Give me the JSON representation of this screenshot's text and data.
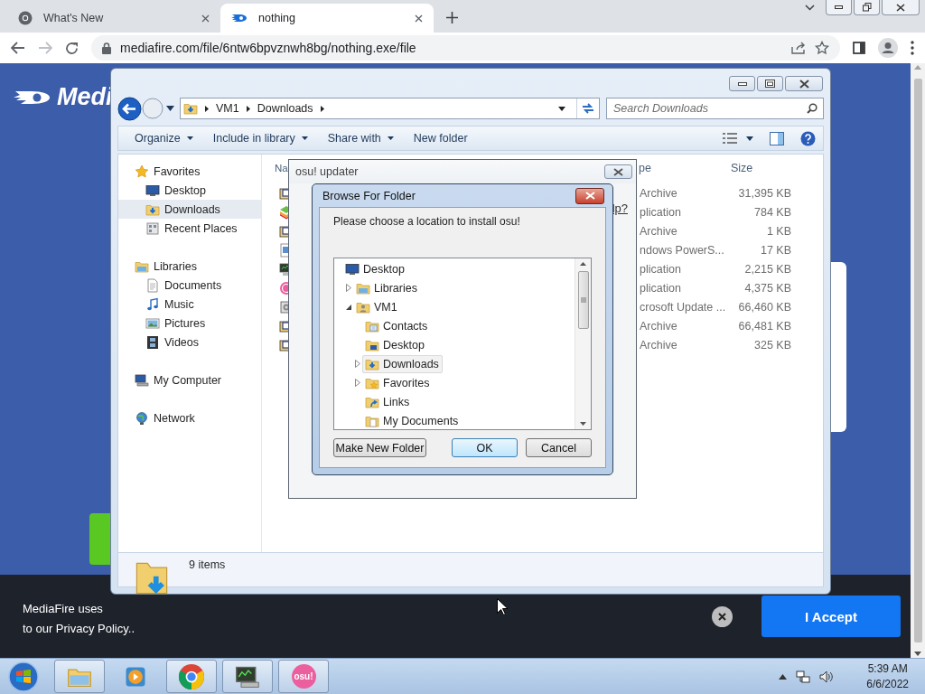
{
  "browser": {
    "tabs": [
      {
        "title": "What's New",
        "selected": false,
        "kind": "chrome"
      },
      {
        "title": "nothing",
        "selected": true,
        "kind": "mediafire"
      }
    ],
    "url": "mediafire.com/file/6ntw6bpvznwh8bg/nothing.exe/file"
  },
  "page": {
    "logo_text": "Medi",
    "cookie_banner": {
      "line_1": "MediaFire uses",
      "line_2": "to our Privacy Policy..",
      "accept": "I Accept"
    }
  },
  "explorer": {
    "breadcrumb": [
      "VM1",
      "Downloads"
    ],
    "search": {
      "placeholder": "Search Downloads"
    },
    "toolbar": [
      {
        "label": "Organize",
        "dropdown": true
      },
      {
        "label": "Include in library",
        "dropdown": true
      },
      {
        "label": "Share with",
        "dropdown": true
      },
      {
        "label": "New folder",
        "dropdown": false
      }
    ],
    "nav": [
      {
        "label": "Favorites",
        "kind": "star",
        "selected": false,
        "items": [
          {
            "label": "Desktop",
            "kind": "desktop",
            "selected": false
          },
          {
            "label": "Downloads",
            "kind": "downloads",
            "selected": true
          },
          {
            "label": "Recent Places",
            "kind": "recent",
            "selected": false
          }
        ]
      },
      {
        "label": "Libraries",
        "kind": "libraries",
        "selected": false,
        "items": [
          {
            "label": "Documents",
            "kind": "document",
            "selected": false
          },
          {
            "label": "Music",
            "kind": "music",
            "selected": false
          },
          {
            "label": "Pictures",
            "kind": "pictures",
            "selected": false
          },
          {
            "label": "Videos",
            "kind": "videos",
            "selected": false
          }
        ]
      },
      {
        "label": "My Computer",
        "kind": "computer",
        "selected": false
      },
      {
        "label": "Network",
        "kind": "network",
        "selected": false
      }
    ],
    "columns": [
      "Na",
      "pe",
      "Size"
    ],
    "files": [
      {
        "kind": "archive",
        "type": "Archive",
        "size": "31,395 KB"
      },
      {
        "kind": "app",
        "type": "plication",
        "size": "784 KB"
      },
      {
        "kind": "archive",
        "type": "Archive",
        "size": "1 KB"
      },
      {
        "kind": "script",
        "type": "ndows PowerS...",
        "size": "17 KB"
      },
      {
        "kind": "monitor",
        "type": "plication",
        "size": "2,215 KB"
      },
      {
        "kind": "osu",
        "type": "plication",
        "size": "4,375 KB"
      },
      {
        "kind": "installer",
        "type": "crosoft Update ...",
        "size": "66,460 KB"
      },
      {
        "kind": "archive",
        "type": "Archive",
        "size": "66,481 KB"
      },
      {
        "kind": "archive",
        "type": "Archive",
        "size": "325 KB"
      }
    ],
    "status": "9 items"
  },
  "updater": {
    "title": "osu! updater",
    "link": "lp?"
  },
  "dialog": {
    "title": "Browse For Folder",
    "prompt": "Please choose a location to install osu!",
    "tree": [
      {
        "label": "Desktop",
        "kind": "desktop",
        "has_arrow": false,
        "selected": false,
        "children": [
          {
            "label": "Libraries",
            "kind": "libraries",
            "has_arrow": true,
            "expanded": false,
            "selected": false
          },
          {
            "label": "VM1",
            "kind": "user",
            "has_arrow": true,
            "expanded": true,
            "selected": false,
            "children": [
              {
                "label": "Contacts",
                "kind": "contacts",
                "has_arrow": false,
                "selected": false
              },
              {
                "label": "Desktop",
                "kind": "desktop-folder",
                "has_arrow": false,
                "selected": false
              },
              {
                "label": "Downloads",
                "kind": "downloads",
                "has_arrow": true,
                "expanded": false,
                "selected": true
              },
              {
                "label": "Favorites",
                "kind": "favorites",
                "has_arrow": true,
                "expanded": false,
                "selected": false
              },
              {
                "label": "Links",
                "kind": "links",
                "has_arrow": false,
                "selected": false
              },
              {
                "label": "My Documents",
                "kind": "documents",
                "has_arrow": false,
                "selected": false
              }
            ]
          }
        ]
      }
    ],
    "buttons": [
      {
        "label": "Make New Folder",
        "default": false
      },
      {
        "label": "OK",
        "default": true
      },
      {
        "label": "Cancel",
        "default": false
      }
    ]
  },
  "taskbar": {
    "apps": [
      {
        "kind": "explorer",
        "running": true
      },
      {
        "kind": "media",
        "running": false
      },
      {
        "kind": "chrome",
        "running": true
      },
      {
        "kind": "monitor",
        "running": true
      },
      {
        "kind": "osu",
        "running": true,
        "label": "osu!"
      }
    ],
    "time": "5:39 AM",
    "date": "6/6/2022"
  }
}
